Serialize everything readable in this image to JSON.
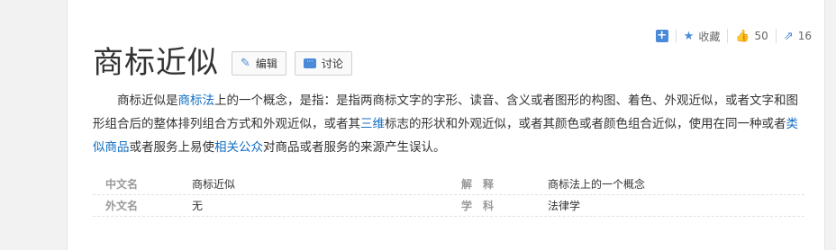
{
  "toolbar": {
    "collect_label": "收藏",
    "like_count": "50",
    "share_count": "16"
  },
  "title": "商标近似",
  "buttons": {
    "edit_label": "编辑",
    "discuss_label": "讨论"
  },
  "summary": {
    "p1": "商标近似是",
    "link1": "商标法",
    "p2": "上的一个概念，是指：是指两商标文字的字形、读音、含义或者图形的构图、着色、外观近似，或者文字和图形组合后的整体排列组合方式和外观近似，或者其",
    "link2": "三维",
    "p3": "标志的形状和外观近似，或者其颜色或者颜色组合近似，使用在同一种或者",
    "link3": "类似商品",
    "p4": "或者服务上易使",
    "link4": "相关公众",
    "p5": "对商品或者服务的来源产生误认。"
  },
  "basic_info": {
    "rows": [
      {
        "k1": "中文名",
        "v1": "商标近似",
        "k2": "解　释",
        "v2": "商标法上的一个概念"
      },
      {
        "k1": "外文名",
        "v1": "无",
        "k2": "学　科",
        "v2": "法律学"
      }
    ]
  }
}
